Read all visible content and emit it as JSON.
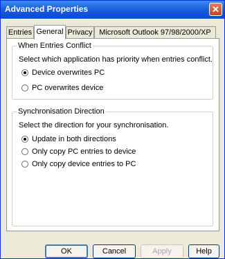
{
  "window": {
    "title": "Advanced Properties",
    "close_symbol": "✕"
  },
  "tabs": [
    {
      "label": "Entries"
    },
    {
      "label": "General"
    },
    {
      "label": "Privacy"
    },
    {
      "label": "Microsoft Outlook 97/98/2000/XP"
    }
  ],
  "conflict": {
    "legend": "When Entries Conflict",
    "description": "Select which application has priority when entries conflict.",
    "options": [
      {
        "label": "Device overwrites PC",
        "selected": true
      },
      {
        "label": "PC overwrites device",
        "selected": false
      }
    ]
  },
  "sync": {
    "legend": "Synchronisation Direction",
    "description": "Select the direction for your synchronisation.",
    "options": [
      {
        "label": "Update in both directions",
        "selected": true
      },
      {
        "label": "Only copy PC entries to device",
        "selected": false
      },
      {
        "label": "Only copy device entries to PC",
        "selected": false
      }
    ]
  },
  "buttons": {
    "ok": "OK",
    "cancel": "Cancel",
    "apply": "Apply",
    "help": "Help"
  },
  "colors": {
    "title_bar": "#1d5fe0",
    "face": "#ece9d8",
    "accent": "#0a47d6"
  }
}
